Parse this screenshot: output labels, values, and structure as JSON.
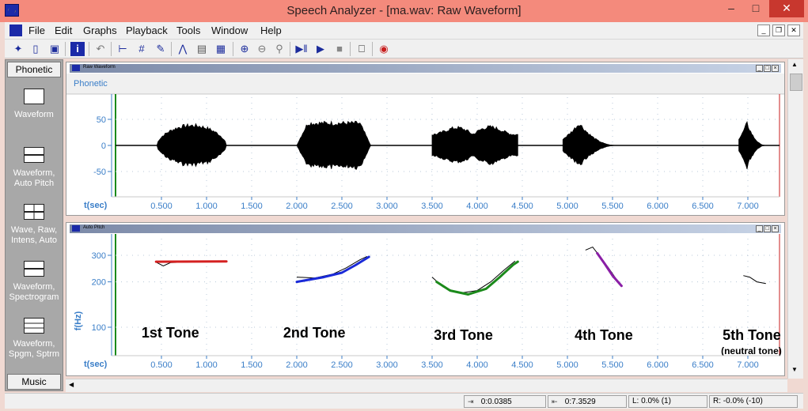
{
  "window": {
    "title": "Speech Analyzer - [ma.wav: Raw Waveform]"
  },
  "menu": [
    "File",
    "Edit",
    "Graphs",
    "Playback",
    "Tools",
    "Window",
    "Help"
  ],
  "toolbar_icons": [
    "pointer-icon",
    "save-icon",
    "info-icon",
    "undo-icon",
    "segment-icon",
    "add-segment-icon",
    "edit-icon",
    "pitch-icon",
    "waveform-icon",
    "spectrum-icon",
    "zoom-in-icon",
    "zoom-out-icon",
    "zoom-all-icon",
    "play-start-icon",
    "play-icon",
    "stop-icon",
    "tape-icon",
    "record-icon"
  ],
  "left_panel": {
    "top_tab": "Phonetic",
    "items": [
      {
        "label": "Waveform",
        "icon": "single-graph-icon"
      },
      {
        "label": "Waveform, Auto Pitch",
        "icon": "two-graph-icon"
      },
      {
        "label": "Wave, Raw, Intens, Auto",
        "icon": "four-graph-icon"
      },
      {
        "label": "Waveform, Spectrogram",
        "icon": "two-graph-icon"
      },
      {
        "label": "Waveform, Spgm, Sptrm",
        "icon": "three-graph-icon"
      }
    ],
    "bottom_tab": "Music"
  },
  "waveform_pane": {
    "title": "Raw Waveform",
    "annotation_label": "Phonetic",
    "x_label": "t(sec)",
    "y_ticks": [
      {
        "value": 50,
        "label": "50"
      },
      {
        "value": 0,
        "label": "0"
      },
      {
        "value": -50,
        "label": "-50"
      }
    ],
    "x_ticks": [
      "0.500",
      "1.000",
      "1.500",
      "2.000",
      "2.500",
      "3.000",
      "3.500",
      "4.000",
      "4.500",
      "5.000",
      "5.500",
      "6.000",
      "6.500",
      "7.000"
    ],
    "bursts": [
      {
        "start": 0.45,
        "end": 1.22,
        "amp": 42,
        "shape": "round"
      },
      {
        "start": 2.0,
        "end": 2.82,
        "amp": 47,
        "shape": "flat"
      },
      {
        "start": 3.5,
        "end": 4.45,
        "amp": 42,
        "shape": "double"
      },
      {
        "start": 4.95,
        "end": 5.55,
        "amp": 47,
        "shape": "peak"
      },
      {
        "start": 6.9,
        "end": 7.2,
        "amp": 47,
        "shape": "peak"
      }
    ]
  },
  "pitch_pane": {
    "title": "Auto Pitch",
    "y_label": "f(Hz)",
    "x_label": "t(sec)",
    "y_ticks": [
      {
        "value": 300,
        "label": "300"
      },
      {
        "value": 200,
        "label": "200"
      },
      {
        "value": 100,
        "label": "100"
      }
    ],
    "x_ticks": [
      "0.500",
      "1.000",
      "1.500",
      "2.000",
      "2.500",
      "3.000",
      "3.500",
      "4.000",
      "4.500",
      "5.000",
      "5.500",
      "6.000",
      "6.500",
      "7.000"
    ],
    "tone_labels": [
      {
        "text": "1st Tone",
        "t": 0.28
      },
      {
        "text": "2nd Tone",
        "t": 1.85
      },
      {
        "text": "3rd Tone",
        "t": 3.52
      },
      {
        "text": "4th Tone",
        "t": 5.08
      },
      {
        "text": "5th Tone",
        "t": 6.72
      }
    ],
    "neutral_note": "(neutral tone)",
    "tones": [
      {
        "color": "#d42020",
        "raw": [
          [
            0.44,
            270
          ],
          [
            0.52,
            255
          ],
          [
            0.6,
            268
          ],
          [
            0.75,
            270
          ],
          [
            0.95,
            272
          ],
          [
            1.2,
            272
          ]
        ],
        "fit": [
          [
            0.44,
            272
          ],
          [
            1.22,
            273
          ]
        ]
      },
      {
        "color": "#1a2ad8",
        "raw": [
          [
            2.0,
            215
          ],
          [
            2.2,
            212
          ],
          [
            2.4,
            225
          ],
          [
            2.55,
            248
          ],
          [
            2.7,
            280
          ],
          [
            2.78,
            295
          ]
        ],
        "fit": [
          [
            2.0,
            200
          ],
          [
            2.3,
            215
          ],
          [
            2.5,
            230
          ],
          [
            2.65,
            258
          ],
          [
            2.8,
            293
          ]
        ]
      },
      {
        "color": "#1b8a1b",
        "raw": [
          [
            3.5,
            215
          ],
          [
            3.62,
            185
          ],
          [
            3.8,
            168
          ],
          [
            4.0,
            175
          ],
          [
            4.15,
            200
          ],
          [
            4.3,
            240
          ],
          [
            4.42,
            275
          ]
        ],
        "fit": [
          [
            3.55,
            200
          ],
          [
            3.7,
            175
          ],
          [
            3.9,
            165
          ],
          [
            4.1,
            180
          ],
          [
            4.25,
            215
          ],
          [
            4.4,
            260
          ],
          [
            4.45,
            272
          ]
        ]
      },
      {
        "color": "#8a1ea6",
        "raw": [
          [
            5.2,
            325
          ],
          [
            5.28,
            340
          ],
          [
            5.35,
            300
          ],
          [
            5.45,
            250
          ],
          [
            5.55,
            205
          ],
          [
            5.6,
            190
          ]
        ],
        "fit": [
          [
            5.33,
            310
          ],
          [
            5.42,
            260
          ],
          [
            5.5,
            220
          ],
          [
            5.6,
            188
          ]
        ]
      },
      {
        "color": "#000000",
        "raw": [
          [
            6.95,
            220
          ],
          [
            7.02,
            215
          ],
          [
            7.1,
            200
          ],
          [
            7.2,
            195
          ]
        ],
        "fit": []
      }
    ]
  },
  "status": {
    "position": "0:0.0385",
    "length": "0:7.3529",
    "left": "L:  0.0%  (1)",
    "right": "R:  -0.0%  (-10)"
  }
}
